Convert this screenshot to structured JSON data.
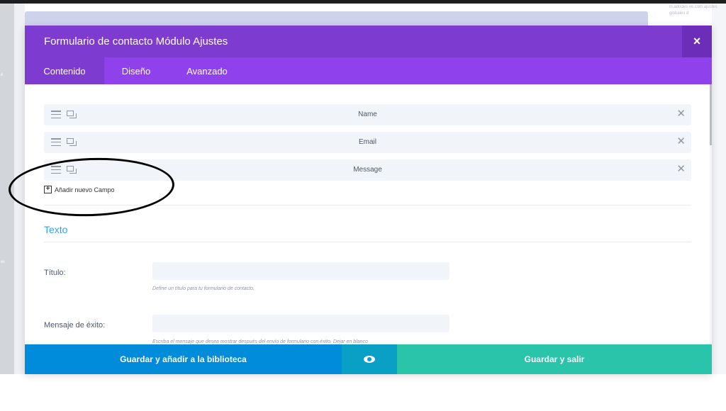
{
  "background": {
    "left_marks": [
      "e",
      "wi"
    ],
    "right_text": "ni.adodes.ve.com ajustes globales d"
  },
  "modal": {
    "title": "Formulario de contacto Módulo Ajustes",
    "close_glyph": "×"
  },
  "tabs": [
    {
      "label": "Contenido",
      "active": true
    },
    {
      "label": "Diseño",
      "active": false
    },
    {
      "label": "Avanzado",
      "active": false
    }
  ],
  "fields": [
    {
      "label": "Name"
    },
    {
      "label": "Email"
    },
    {
      "label": "Message"
    }
  ],
  "add_field": {
    "icon": "plus-box-icon",
    "label": "Añadir nuevo Campo"
  },
  "text_section": {
    "title": "Texto",
    "title_field": {
      "label": "Título:",
      "value": "",
      "help": "Define un título para tu formulario de contacto."
    },
    "success_field": {
      "label": "Mensaje de éxito:",
      "value": "",
      "help": "Escriba el mensaje que desea mostrar después del envío de formulario con éxito. Dejar en blanco"
    }
  },
  "footer": {
    "save_library_label": "Guardar y añadir a la biblioteca",
    "preview_icon": "eye-icon",
    "save_exit_label": "Guardar y salir"
  },
  "colors": {
    "header": "#7e3bd0",
    "tabs": "#8f42ec",
    "save_library": "#008bdb",
    "preview": "#0aa0c6",
    "save_exit": "#29c4a9",
    "section_title": "#2ea3f2"
  }
}
